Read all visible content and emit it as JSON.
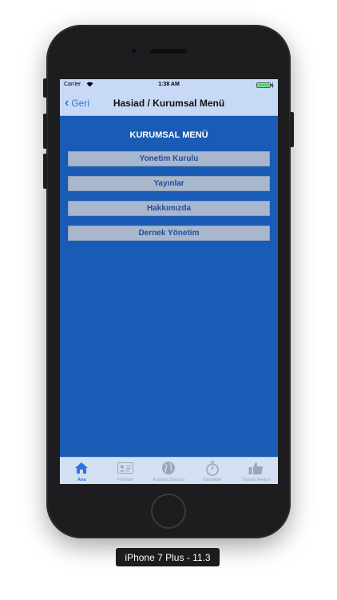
{
  "status_bar": {
    "carrier": "Carrier",
    "time": "1:38 AM"
  },
  "nav_bar": {
    "back_label": "Geri",
    "title": "Hasiad / Kurumsal Menü"
  },
  "content": {
    "section_title": "KURUMSAL MENÜ",
    "menu_items": [
      {
        "label": "Yonetim Kurulu"
      },
      {
        "label": "Yayınlar"
      },
      {
        "label": "Hakkımızda"
      },
      {
        "label": "Dernek Yönetim"
      }
    ]
  },
  "tab_bar": {
    "tabs": [
      {
        "label": "Ana",
        "icon": "home-icon",
        "active": true
      },
      {
        "label": "Firmalar",
        "icon": "id-card-icon",
        "active": false
      },
      {
        "label": "Avantaj Dünyası",
        "icon": "globe-icon",
        "active": false
      },
      {
        "label": "Etkinlikler",
        "icon": "stopwatch-icon",
        "active": false
      },
      {
        "label": "Sosyal Medya",
        "icon": "thumbs-up-icon",
        "active": false
      }
    ]
  },
  "device_label": "iPhone 7 Plus - 11.3",
  "colors": {
    "screen_background": "#1a5cb5",
    "nav_background": "#c7d9f4",
    "accent": "#2f73e0",
    "menu_button": "#a8b7cc",
    "menu_text": "#1d4f9c",
    "device_frame": "#1d1d1f"
  }
}
